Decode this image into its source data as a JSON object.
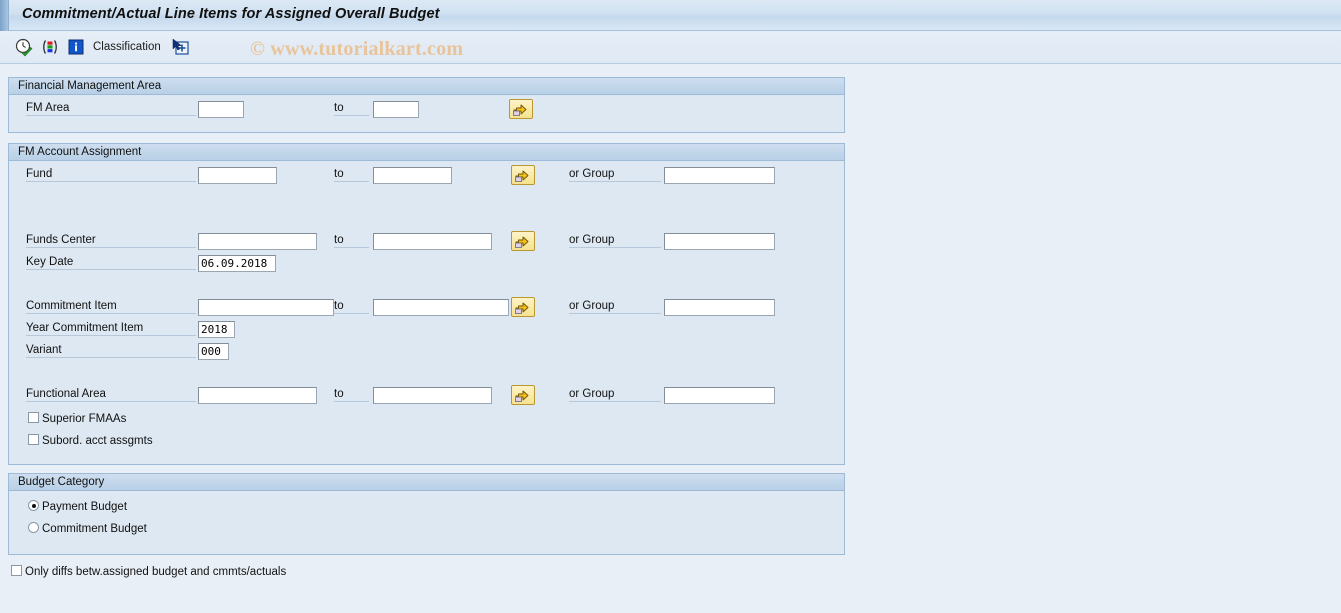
{
  "window": {
    "title": "Commitment/Actual Line Items for Assigned Overall Budget"
  },
  "toolbar": {
    "execute_icon": "execute-clock-check-icon",
    "chart_icon": "variant-chart-icon",
    "info_icon": "info-icon",
    "classification_label": "Classification",
    "classification_add_icon": "add-selection-icon"
  },
  "watermark": "© www.tutorialkart.com",
  "sections": {
    "fm_area": {
      "title": "Financial Management Area",
      "rows": [
        {
          "label": "FM Area",
          "from_value": "",
          "to_label": "to",
          "to_value": "",
          "multi_select": "multiple-selection-icon"
        }
      ]
    },
    "fm_account_assignment": {
      "title": "FM Account Assignment",
      "fund": {
        "label": "Fund",
        "from_value": "",
        "to_label": "to",
        "to_value": "",
        "group_label": "or Group",
        "group_value": ""
      },
      "funds_center": {
        "label": "Funds Center",
        "from_value": "",
        "to_label": "to",
        "to_value": "",
        "group_label": "or Group",
        "group_value": ""
      },
      "key_date": {
        "label": "Key Date",
        "value": "06.09.2018"
      },
      "commitment_item": {
        "label": "Commitment Item",
        "from_value": "",
        "to_label": "to",
        "to_value": "",
        "group_label": "or Group",
        "group_value": ""
      },
      "year_commitment_item": {
        "label": "Year Commitment Item",
        "value": "2018"
      },
      "variant": {
        "label": "Variant",
        "value": "000"
      },
      "functional_area": {
        "label": "Functional Area",
        "from_value": "",
        "to_label": "to",
        "to_value": "",
        "group_label": "or Group",
        "group_value": ""
      },
      "superior_fmaas": {
        "label": "Superior FMAAs",
        "checked": false
      },
      "subord_acct_assgmts": {
        "label": "Subord. acct assgmts",
        "checked": false
      }
    },
    "budget_category": {
      "title": "Budget Category",
      "options": [
        {
          "label": "Payment Budget",
          "selected": true
        },
        {
          "label": "Commitment Budget",
          "selected": false
        }
      ]
    }
  },
  "footer": {
    "only_diffs": {
      "label": "Only diffs betw.assigned budget and cmmts/actuals",
      "checked": false
    }
  },
  "colors": {
    "panel_bg": "#dde8f2",
    "panel_border": "#9dbad6",
    "page_bg": "#e9eff7",
    "title_bg": "#cfe0f0",
    "button_yellow": "#f6e28e",
    "watermark": "#e8c49a"
  }
}
